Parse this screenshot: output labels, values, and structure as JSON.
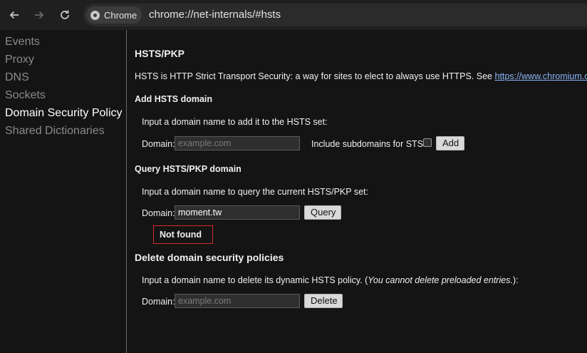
{
  "toolbar": {
    "back_icon": "arrow-left-icon",
    "forward_icon": "arrow-right-icon",
    "reload_icon": "reload-icon",
    "chip_label": "Chrome",
    "url": "chrome://net-internals/#hsts"
  },
  "sidebar": {
    "items": [
      {
        "label": "Events",
        "active": false
      },
      {
        "label": "Proxy",
        "active": false
      },
      {
        "label": "DNS",
        "active": false
      },
      {
        "label": "Sockets",
        "active": false
      },
      {
        "label": "Domain Security Policy",
        "active": true
      },
      {
        "label": "Shared Dictionaries",
        "active": false
      }
    ]
  },
  "main": {
    "title": "HSTS/PKP",
    "intro": "HSTS is HTTP Strict Transport Security: a way for sites to elect to always use HTTPS. See",
    "intro_link": "https://www.chromium.org/hsts",
    "intro_end": ".",
    "add": {
      "heading": "Add HSTS domain",
      "instruction": "Input a domain name to add it to the HSTS set:",
      "domain_label": "Domain:",
      "placeholder": "example.com",
      "subdomains_label": "Include subdomains for STS:",
      "button": "Add"
    },
    "query": {
      "heading": "Query HSTS/PKP domain",
      "instruction": "Input a domain name to query the current HSTS/PKP set:",
      "domain_label": "Domain:",
      "value": "moment.tw",
      "button": "Query",
      "result": "Not found"
    },
    "delete": {
      "heading": "Delete domain security policies",
      "instruction_start": "Input a domain name to delete its dynamic HSTS policy. (",
      "instruction_italic": "You cannot delete preloaded entries.",
      "instruction_end": "):",
      "domain_label": "Domain:",
      "placeholder": "example.com",
      "button": "Delete"
    }
  },
  "colors": {
    "background": "#141414",
    "link": "#8ab4f8",
    "result_border": "#d12c2c"
  }
}
